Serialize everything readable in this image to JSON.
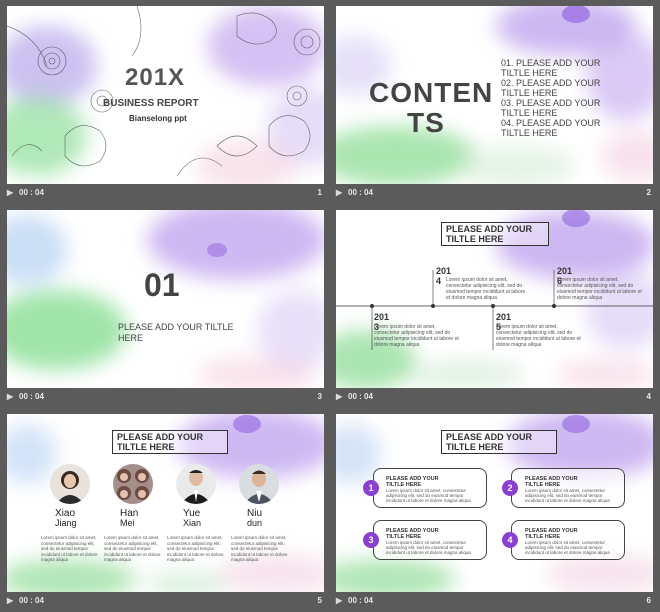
{
  "duration_label": "00 : 04",
  "colors": {
    "purple": "#8a3fcf",
    "green": "#79d17f",
    "frame_bg": "#5b5b5b"
  },
  "slides": [
    {
      "number": "1",
      "title": "201X",
      "subtitle": "BUSINESS REPORT",
      "author": "Bianselong ppt"
    },
    {
      "number": "2",
      "heading_line1": "CONTEN",
      "heading_line2": "TS",
      "items": [
        "01. PLEASE ADD YOUR TILTLE HERE",
        "02. PLEASE ADD YOUR TILTLE HERE",
        "03. PLEASE ADD YOUR TILTLE HERE",
        "04. PLEASE ADD YOUR TILTLE HERE"
      ]
    },
    {
      "number": "3",
      "big_number": "01",
      "title": "PLEASE ADD YOUR TILTLE HERE"
    },
    {
      "number": "4",
      "title": "PLEASE ADD YOUR TILTLE HERE",
      "nodes": [
        {
          "year": "201\n4",
          "text": "Lorem ipsum dolor sit amet, consectetur adipisicing elit, sed do eiusmod tempor incididunt ut labore et dolore magna aliqua"
        },
        {
          "year": "201\n6",
          "text": "Lorem ipsum dolor sit amet, consectetur adipisicing elit, sed do eiusmod tempor incididunt ut labore et dolore magna aliqua"
        },
        {
          "year": "201\n3",
          "text": "Lorem ipsum dolor sit amet, consectetur adipisicing elit, sed do eiusmod tempor incididunt ut labore et dolore magna aliqua"
        },
        {
          "year": "201\n5",
          "text": "Lorem ipsum dolor sit amet, consectetur adipisicing elit, sed do eiusmod tempor incididunt ut labore et dolore magna aliqua"
        }
      ]
    },
    {
      "number": "5",
      "title": "PLEASE ADD YOUR TILTLE HERE",
      "people": [
        {
          "name": "Xiao",
          "role": "Jiang",
          "text": "Lorem ipsum dolor sit amet, consectetur adipisicing elit, sed do eiusmod tempor incididunt ut labore et dolore magna aliqua"
        },
        {
          "name": "Han",
          "role": "Mei",
          "text": "Lorem ipsum dolor sit amet, consectetur adipisicing elit, sed do eiusmod tempor incididunt ut labore et dolore magna aliqua"
        },
        {
          "name": "Yue",
          "role": "Xian",
          "text": "Lorem ipsum dolor sit amet, consectetur adipisicing elit, sed do eiusmod tempor incididunt ut labore et dolore magna aliqua"
        },
        {
          "name": "Niu",
          "role": "dun",
          "text": "Lorem ipsum dolor sit amet, consectetur adipisicing elit, sed do eiusmod tempor incididunt ut labore et dolore magna aliqua"
        }
      ]
    },
    {
      "number": "6",
      "title": "PLEASE ADD YOUR TILTLE HERE",
      "boxes": [
        {
          "num": "1",
          "title": "PLEASE ADD YOUR TILTLE HERE",
          "text": "Lorem ipsum dolor sit amet, consectetur adipisicing elit, sed do eiusmod tempor incididunt ut labore et dolore magna aliqua"
        },
        {
          "num": "2",
          "title": "PLEASE ADD YOUR TILTLE HERE",
          "text": "Lorem ipsum dolor sit amet, consectetur adipisicing elit, sed do eiusmod tempor incididunt ut labore et dolore magna aliqua"
        },
        {
          "num": "3",
          "title": "PLEASE ADD YOUR TILTLE HERE",
          "text": "Lorem ipsum dolor sit amet, consectetur adipisicing elit, sed do eiusmod tempor incididunt ut labore et dolore magna aliqua"
        },
        {
          "num": "4",
          "title": "PLEASE ADD YOUR TILTLE HERE",
          "text": "Lorem ipsum dolor sit amet, consectetur adipisicing elit, sed do eiusmod tempor incididunt ut labore et dolore magna aliqua"
        }
      ]
    }
  ]
}
